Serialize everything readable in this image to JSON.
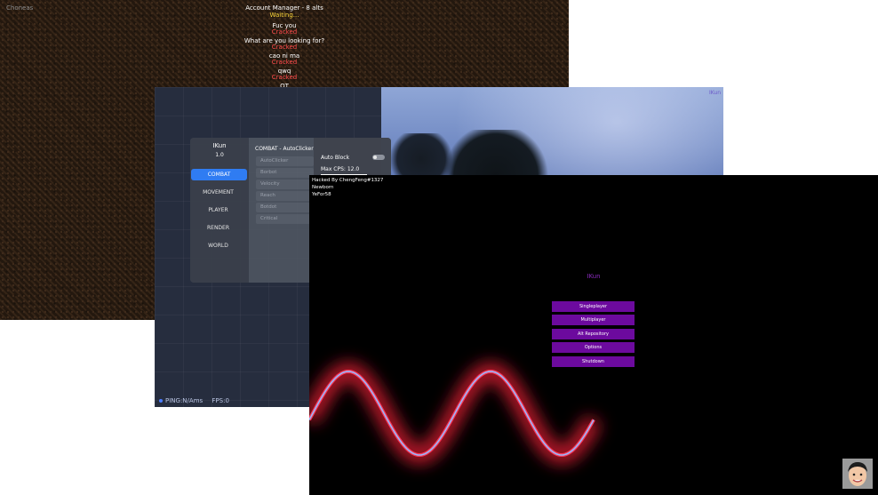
{
  "account_manager": {
    "corner_label": "Choneas",
    "title": "Account Manager - 8 alts",
    "status_waiting": "Waiting...",
    "accounts": [
      {
        "name": "Fuc you",
        "status": "Cracked"
      },
      {
        "name": "What are you looking for?",
        "status": "Cracked"
      },
      {
        "name": "cao ni ma",
        "status": "Cracked"
      },
      {
        "name": "qwq",
        "status": "Cracked"
      },
      {
        "name": "QT",
        "status": ""
      }
    ]
  },
  "click_gui": {
    "client_name": "IKun",
    "version": "1.0",
    "categories": [
      "COMBAT",
      "MOVEMENT",
      "PLAYER",
      "RENDER",
      "WORLD"
    ],
    "active_category": "COMBAT",
    "section_title": "COMBAT - AutoClicker",
    "modules": [
      "AutoClicker",
      "Borbot",
      "Velocity",
      "Reach",
      "Botdot",
      "Critical"
    ],
    "settings": {
      "auto_block_label": "Auto Block",
      "auto_block_on": false,
      "max_cps_label": "Max CPS: 12.0"
    },
    "corner_label": "IKun",
    "status": {
      "ping": "PING:N/Ams",
      "fps": "FPS:0"
    }
  },
  "main_menu": {
    "info_lines": [
      "Hacked By ChengFeng#1327",
      "Newborn",
      "YeFor58"
    ],
    "client_name": "IKun",
    "buttons": [
      "Singleplayer",
      "Multiplayer",
      "Alt Repository",
      "Options",
      "Shutdown"
    ],
    "wave_color": "#ff1f3a",
    "button_color": "#6c0a9e"
  }
}
